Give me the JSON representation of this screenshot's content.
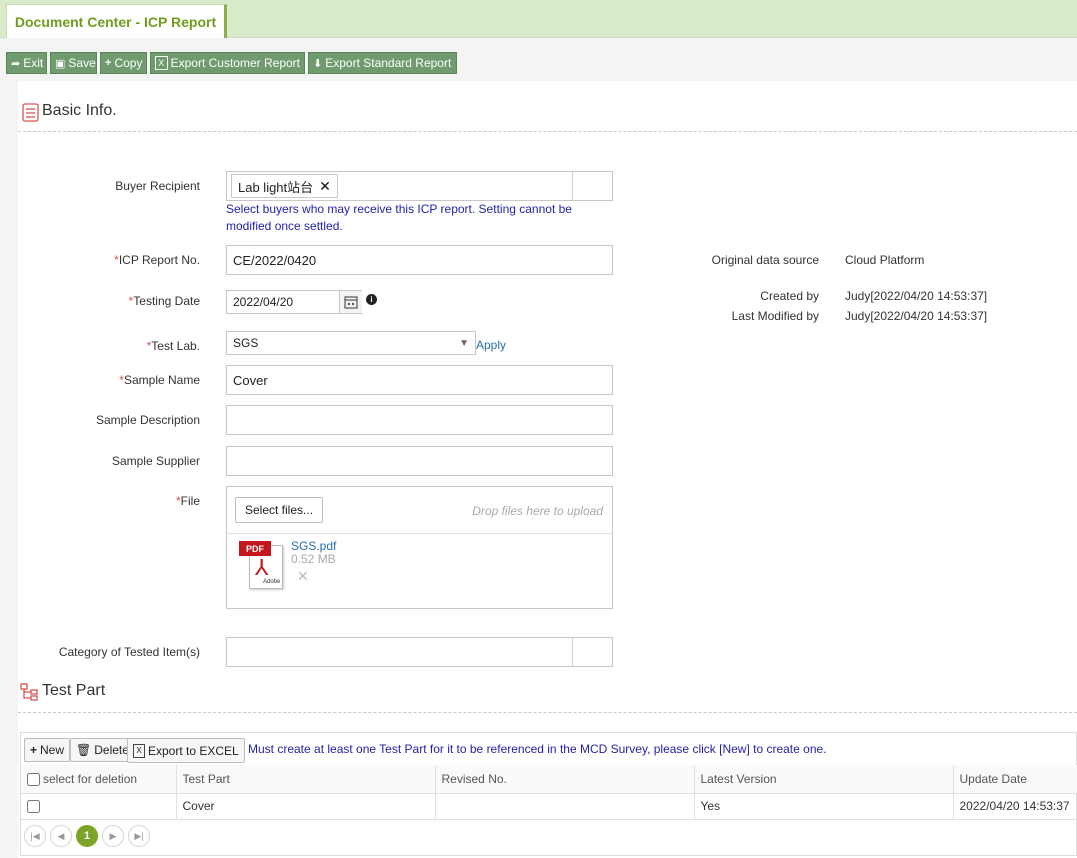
{
  "tab": {
    "title": "Document Center - ICP Report"
  },
  "toolbar": {
    "exit": "Exit",
    "save": "Save",
    "copy": "Copy",
    "export_customer": "Export Customer Report",
    "export_standard": "Export Standard Report"
  },
  "basic_info": {
    "title": "Basic Info.",
    "buyer_recipient": {
      "label": "Buyer Recipient",
      "chip": "Lab light站台",
      "hint": "Select buyers who may receive this ICP report. Setting cannot be modified once settled."
    },
    "icp_report_no": {
      "label": "ICP Report No.",
      "value": "CE/2022/0420"
    },
    "testing_date": {
      "label": "Testing Date",
      "value": "2022/04/20"
    },
    "test_lab": {
      "label": "Test Lab.",
      "value": "SGS",
      "apply": "Apply"
    },
    "sample_name": {
      "label": "Sample Name",
      "value": "Cover"
    },
    "sample_description": {
      "label": "Sample Description",
      "value": ""
    },
    "sample_supplier": {
      "label": "Sample Supplier",
      "value": ""
    },
    "file": {
      "label": "File",
      "select_button": "Select files...",
      "drop_hint": "Drop files here to upload",
      "file_name": "SGS.pdf",
      "file_size": "0.52 MB",
      "pdf_badge": "PDF",
      "adobe": "Adobe"
    },
    "category": {
      "label": "Category of Tested Item(s)",
      "value": ""
    }
  },
  "meta": {
    "source_label": "Original data source",
    "source_value": "Cloud Platform",
    "created_label": "Created by",
    "created_value": "Judy[2022/04/20 14:53:37]",
    "modified_label": "Last Modified by",
    "modified_value": "Judy[2022/04/20 14:53:37]"
  },
  "test_part": {
    "title": "Test Part",
    "new": "New",
    "delete": "Delete",
    "export_excel": "Export to EXCEL",
    "notice": "Must create at least one Test Part for it to be referenced in the MCD Survey, please click [New] to create one.",
    "columns": {
      "select": "select for deletion",
      "part": "Test Part",
      "revised": "Revised No.",
      "latest": "Latest Version",
      "update": "Update Date"
    },
    "rows": [
      {
        "part": "Cover",
        "revised": "",
        "latest": "Yes",
        "update": "2022/04/20 14:53:37"
      }
    ],
    "pager": {
      "current": "1"
    }
  }
}
